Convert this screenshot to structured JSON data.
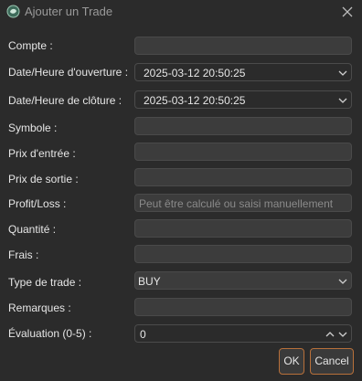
{
  "window": {
    "title": "Ajouter un Trade",
    "app_icon": "app-logo-icon",
    "close_icon": "close-icon"
  },
  "form": {
    "compte": {
      "label": "Compte :",
      "value": ""
    },
    "open_datetime": {
      "label": "Date/Heure d'ouverture :",
      "value": "2025-03-12 20:50:25"
    },
    "close_datetime": {
      "label": "Date/Heure de clôture :",
      "value": "2025-03-12 20:50:25"
    },
    "symbole": {
      "label": "Symbole :",
      "value": ""
    },
    "prix_entree": {
      "label": "Prix d'entrée :",
      "value": ""
    },
    "prix_sortie": {
      "label": "Prix de sortie :",
      "value": ""
    },
    "profit_loss": {
      "label": "Profit/Loss :",
      "value": "",
      "placeholder": "Peut être calculé ou saisi manuellement"
    },
    "quantite": {
      "label": "Quantité :",
      "value": ""
    },
    "frais": {
      "label": "Frais :",
      "value": ""
    },
    "type_trade": {
      "label": "Type de trade :",
      "value": "BUY"
    },
    "remarques": {
      "label": "Remarques :",
      "value": ""
    },
    "evaluation": {
      "label": "Évaluation (0-5) :",
      "value": "0"
    }
  },
  "buttons": {
    "ok": "OK",
    "cancel": "Cancel"
  },
  "colors": {
    "background": "#2b2b2b",
    "field": "#3c3c3c",
    "accent": "#b8703a",
    "text": "#e6e6e6",
    "placeholder": "#8a8a8a"
  }
}
